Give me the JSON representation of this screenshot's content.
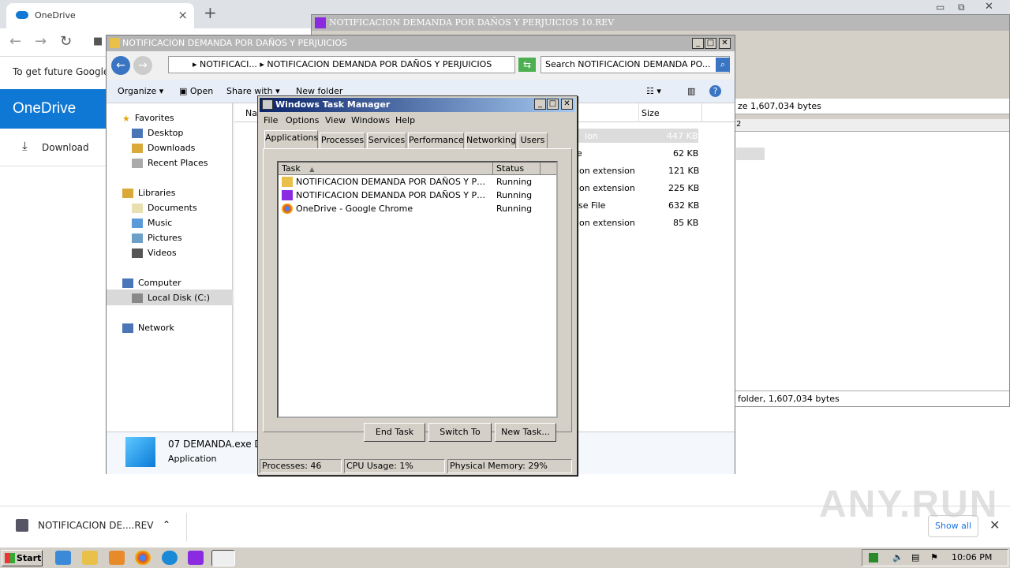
{
  "chrome": {
    "tab_title": "OneDrive",
    "info_text": "To get future Google",
    "onedrive_header": "OneDrive",
    "download_label": "Download",
    "download_item": "NOTIFICACION DE....REV",
    "show_all": "Show all",
    "watermark": "ANY.RUN"
  },
  "winrar": {
    "title": "NOTIFICACION DEMANDA POR DAÑOS Y PERJUICIOS 10.REV",
    "status_top": "ze 1,607,034 bytes",
    "status_bottom": "folder, 1,607,034 bytes",
    "col2": "2"
  },
  "explorer": {
    "title": "NOTIFICACION DEMANDA POR DAÑOS Y PERJUICIOS",
    "address": "▸ NOTIFICACI... ▸ NOTIFICACION DEMANDA POR DAÑOS Y PERJUICIOS",
    "search_placeholder": "Search NOTIFICACION DEMANDA PO...",
    "toolbar": {
      "organize": "Organize ▾",
      "open": "Open",
      "share_with": "Share with ▾",
      "new_folder": "New folder"
    },
    "nav": {
      "favorites": "Favorites",
      "desktop": "Desktop",
      "downloads": "Downloads",
      "recent": "Recent Places",
      "libraries": "Libraries",
      "documents": "Documents",
      "music": "Music",
      "pictures": "Pictures",
      "videos": "Videos",
      "computer": "Computer",
      "local_disk": "Local Disk (C:)",
      "network": "Network"
    },
    "columns": {
      "name": "Na",
      "size": "Size"
    },
    "files": [
      {
        "type": "ion",
        "size": "447 KB"
      },
      {
        "type": "e",
        "size": "62 KB"
      },
      {
        "type": "ion extension",
        "size": "121 KB"
      },
      {
        "type": "ion extension",
        "size": "225 KB"
      },
      {
        "type": "se File",
        "size": "632 KB"
      },
      {
        "type": "ion extension",
        "size": "85 KB"
      }
    ],
    "details": {
      "name": "07 DEMANDA.exe D",
      "kind": "Application"
    }
  },
  "taskmgr": {
    "title": "Windows Task Manager",
    "menu": [
      "File",
      "Options",
      "View",
      "Windows",
      "Help"
    ],
    "tabs": [
      "Applications",
      "Processes",
      "Services",
      "Performance",
      "Networking",
      "Users"
    ],
    "col_task": "Task",
    "col_status": "Status",
    "rows": [
      {
        "task": "NOTIFICACION DEMANDA POR DAÑOS Y PERJU...",
        "status": "Running"
      },
      {
        "task": "NOTIFICACION DEMANDA POR DAÑOS Y PERJU...",
        "status": "Running"
      },
      {
        "task": "OneDrive - Google Chrome",
        "status": "Running"
      }
    ],
    "buttons": {
      "end_task": "End Task",
      "switch_to": "Switch To",
      "new_task": "New Task..."
    },
    "status": {
      "processes": "Processes: 46",
      "cpu": "CPU Usage: 1%",
      "memory": "Physical Memory: 29%"
    }
  },
  "taskbar": {
    "start": "Start",
    "clock": "10:06 PM"
  }
}
